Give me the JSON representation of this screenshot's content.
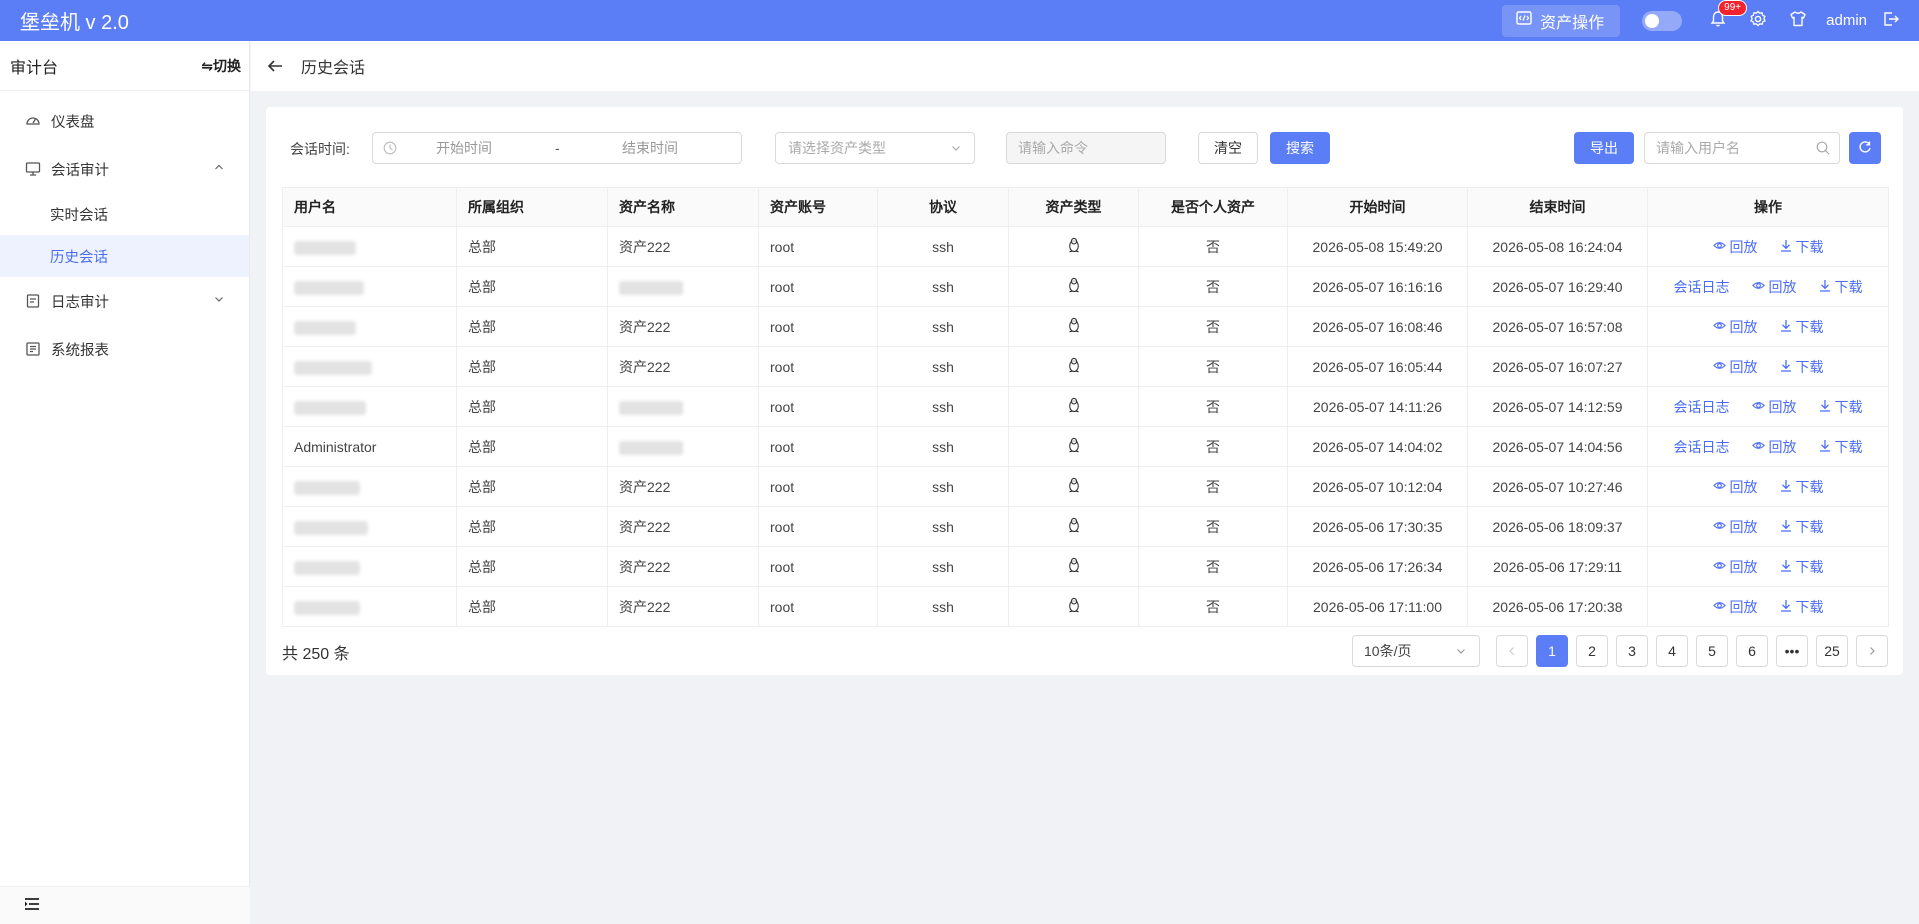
{
  "app": {
    "title": "堡垒机 v 2.0"
  },
  "header": {
    "asset_op_label": "资产操作",
    "notification_badge": "99+",
    "user": "admin"
  },
  "sidebar": {
    "title": "审计台",
    "switch_label": "⇋切换",
    "items": [
      {
        "label": "仪表盘"
      },
      {
        "label": "会话审计",
        "sub": [
          "实时会话",
          "历史会话"
        ]
      },
      {
        "label": "日志审计"
      },
      {
        "label": "系统报表"
      }
    ]
  },
  "breadcrumb": {
    "title": "历史会话"
  },
  "filters": {
    "session_time_label": "会话时间:",
    "start_placeholder": "开始时间",
    "range_sep": "-",
    "end_placeholder": "结束时间",
    "asset_type_placeholder": "请选择资产类型",
    "command_placeholder": "请输入命令",
    "clear_label": "清空",
    "search_label": "搜索",
    "export_label": "导出",
    "username_placeholder": "请输入用户名"
  },
  "table": {
    "columns": [
      "用户名",
      "所属组织",
      "资产名称",
      "资产账号",
      "协议",
      "资产类型",
      "是否个人资产",
      "开始时间",
      "结束时间",
      "操作"
    ],
    "rows": [
      {
        "user": "",
        "org": "总部",
        "asset": "资产222",
        "account": "root",
        "protocol": "ssh",
        "personal": "否",
        "start": "2026-05-08 15:49:20",
        "end": "2026-05-08 16:24:04",
        "log": false
      },
      {
        "user": "",
        "org": "总部",
        "asset": "",
        "account": "root",
        "protocol": "ssh",
        "personal": "否",
        "start": "2026-05-07 16:16:16",
        "end": "2026-05-07 16:29:40",
        "log": true
      },
      {
        "user": "",
        "org": "总部",
        "asset": "资产222",
        "account": "root",
        "protocol": "ssh",
        "personal": "否",
        "start": "2026-05-07 16:08:46",
        "end": "2026-05-07 16:57:08",
        "log": false
      },
      {
        "user": "",
        "org": "总部",
        "asset": "资产222",
        "account": "root",
        "protocol": "ssh",
        "personal": "否",
        "start": "2026-05-07 16:05:44",
        "end": "2026-05-07 16:07:27",
        "log": false
      },
      {
        "user": "",
        "org": "总部",
        "asset": "",
        "account": "root",
        "protocol": "ssh",
        "personal": "否",
        "start": "2026-05-07 14:11:26",
        "end": "2026-05-07 14:12:59",
        "log": true
      },
      {
        "user": "Administrator",
        "org": "总部",
        "asset": "",
        "account": "root",
        "protocol": "ssh",
        "personal": "否",
        "start": "2026-05-07 14:04:02",
        "end": "2026-05-07 14:04:56",
        "log": true
      },
      {
        "user": "",
        "org": "总部",
        "asset": "资产222",
        "account": "root",
        "protocol": "ssh",
        "personal": "否",
        "start": "2026-05-07 10:12:04",
        "end": "2026-05-07 10:27:46",
        "log": false
      },
      {
        "user": "",
        "org": "总部",
        "asset": "资产222",
        "account": "root",
        "protocol": "ssh",
        "personal": "否",
        "start": "2026-05-06 17:30:35",
        "end": "2026-05-06 18:09:37",
        "log": false
      },
      {
        "user": "",
        "org": "总部",
        "asset": "资产222",
        "account": "root",
        "protocol": "ssh",
        "personal": "否",
        "start": "2026-05-06 17:26:34",
        "end": "2026-05-06 17:29:11",
        "log": false
      },
      {
        "user": "",
        "org": "总部",
        "asset": "资产222",
        "account": "root",
        "protocol": "ssh",
        "personal": "否",
        "start": "2026-05-06 17:11:00",
        "end": "2026-05-06 17:20:38",
        "log": false
      }
    ],
    "op_labels": {
      "log": "会话日志",
      "replay": "回放",
      "download": "下载"
    }
  },
  "pagination": {
    "total": "共 250 条",
    "page_size": "10条/页",
    "pages": [
      "1",
      "2",
      "3",
      "4",
      "5",
      "6",
      "•••",
      "25"
    ],
    "current": "1"
  },
  "colors": {
    "primary": "#5b7df5",
    "link": "#4a6cf7"
  }
}
